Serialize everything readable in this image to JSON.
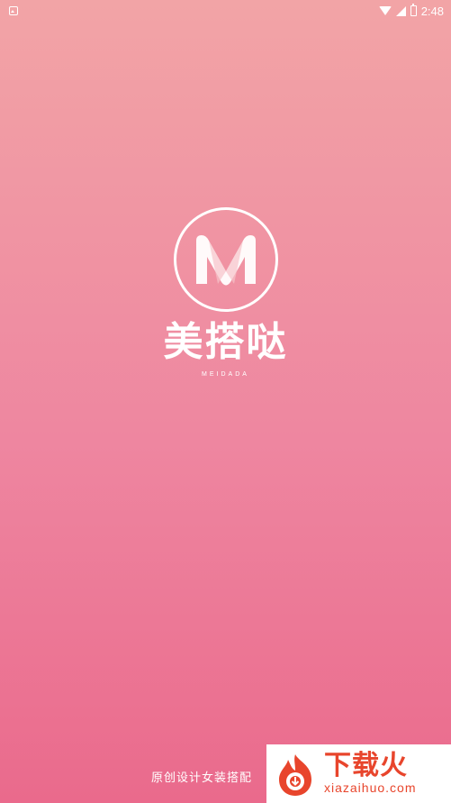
{
  "status_bar": {
    "time": "2:48",
    "icons": [
      "notification-icon",
      "wifi-icon",
      "signal-icon",
      "battery-icon"
    ]
  },
  "logo": {
    "letter": "M",
    "name": "美搭哒",
    "subtitle": "MEIDADA"
  },
  "slogan": "原创设计女装搭配",
  "watermark": {
    "name": "下载火",
    "domain": "xiazaihuo.com"
  },
  "colors": {
    "gradient_top": "#f2a4a6",
    "gradient_bottom": "#ea6a8c",
    "watermark_accent": "#e8452c"
  }
}
